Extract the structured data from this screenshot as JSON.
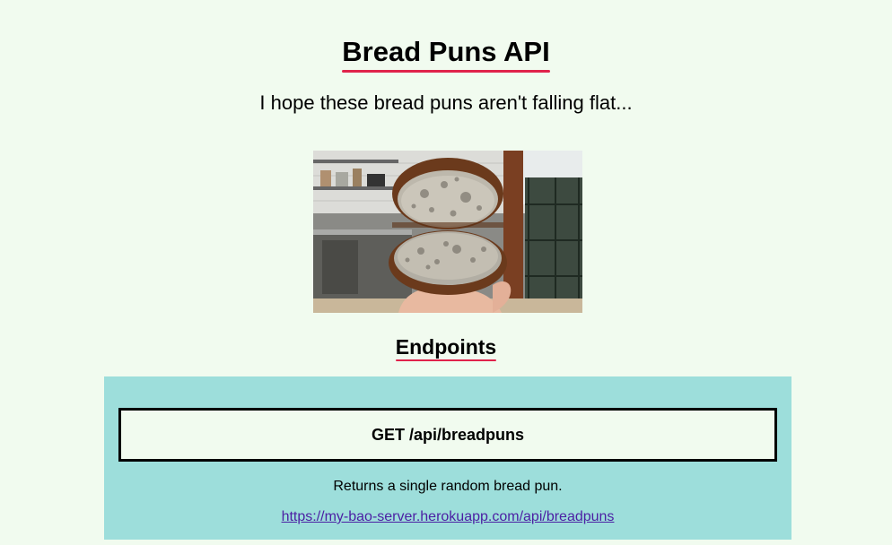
{
  "header": {
    "title": "Bread Puns API",
    "subtitle": "I hope these bread puns aren't falling flat..."
  },
  "hero_image": {
    "description_icon": "bread-loaf-photo"
  },
  "endpoints": {
    "section_title": "Endpoints",
    "items": [
      {
        "method_path": "GET /api/breadpuns",
        "description": "Returns a single random bread pun.",
        "link": "https://my-bao-server.herokuapp.com/api/breadpuns"
      }
    ]
  },
  "colors": {
    "background": "#f1fbef",
    "accent_underline": "#e0234b",
    "panel": "#9ddedb",
    "link": "#4b1fa3"
  }
}
